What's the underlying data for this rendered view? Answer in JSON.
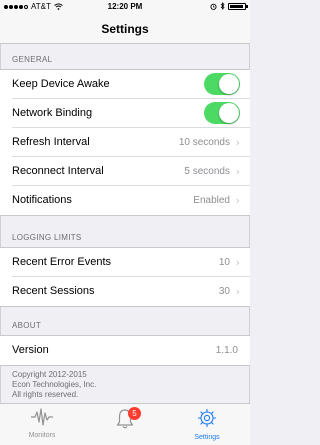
{
  "status_bar": {
    "carrier": "AT&T",
    "time": "12:20 PM"
  },
  "nav": {
    "title": "Settings"
  },
  "sections": {
    "general": {
      "header": "GENERAL",
      "keep_awake": {
        "label": "Keep Device Awake",
        "on": true
      },
      "network_binding": {
        "label": "Network Binding",
        "on": true
      },
      "refresh": {
        "label": "Refresh Interval",
        "value": "10 seconds"
      },
      "reconnect": {
        "label": "Reconnect Interval",
        "value": "5 seconds"
      },
      "notifications": {
        "label": "Notifications",
        "value": "Enabled"
      }
    },
    "logging": {
      "header": "LOGGING LIMITS",
      "errors": {
        "label": "Recent Error Events",
        "value": "10"
      },
      "sessions": {
        "label": "Recent Sessions",
        "value": "30"
      }
    },
    "about": {
      "header": "ABOUT",
      "version": {
        "label": "Version",
        "value": "1.1.0"
      },
      "copyright_lines": [
        "Copyright 2012-2015",
        "Econ Technologies, Inc.",
        "All rights reserved."
      ]
    }
  },
  "tabbar": {
    "tabs": [
      {
        "label": "Monitors",
        "icon": "waveform-icon",
        "active": false
      },
      {
        "label": "",
        "icon": "bell-icon",
        "badge": "5",
        "active": false
      },
      {
        "label": "Settings",
        "icon": "gear-icon",
        "active": true
      }
    ]
  },
  "colors": {
    "toggle_on": "#4cd964",
    "accent": "#1e7cf2",
    "badge": "#ff3b30"
  }
}
